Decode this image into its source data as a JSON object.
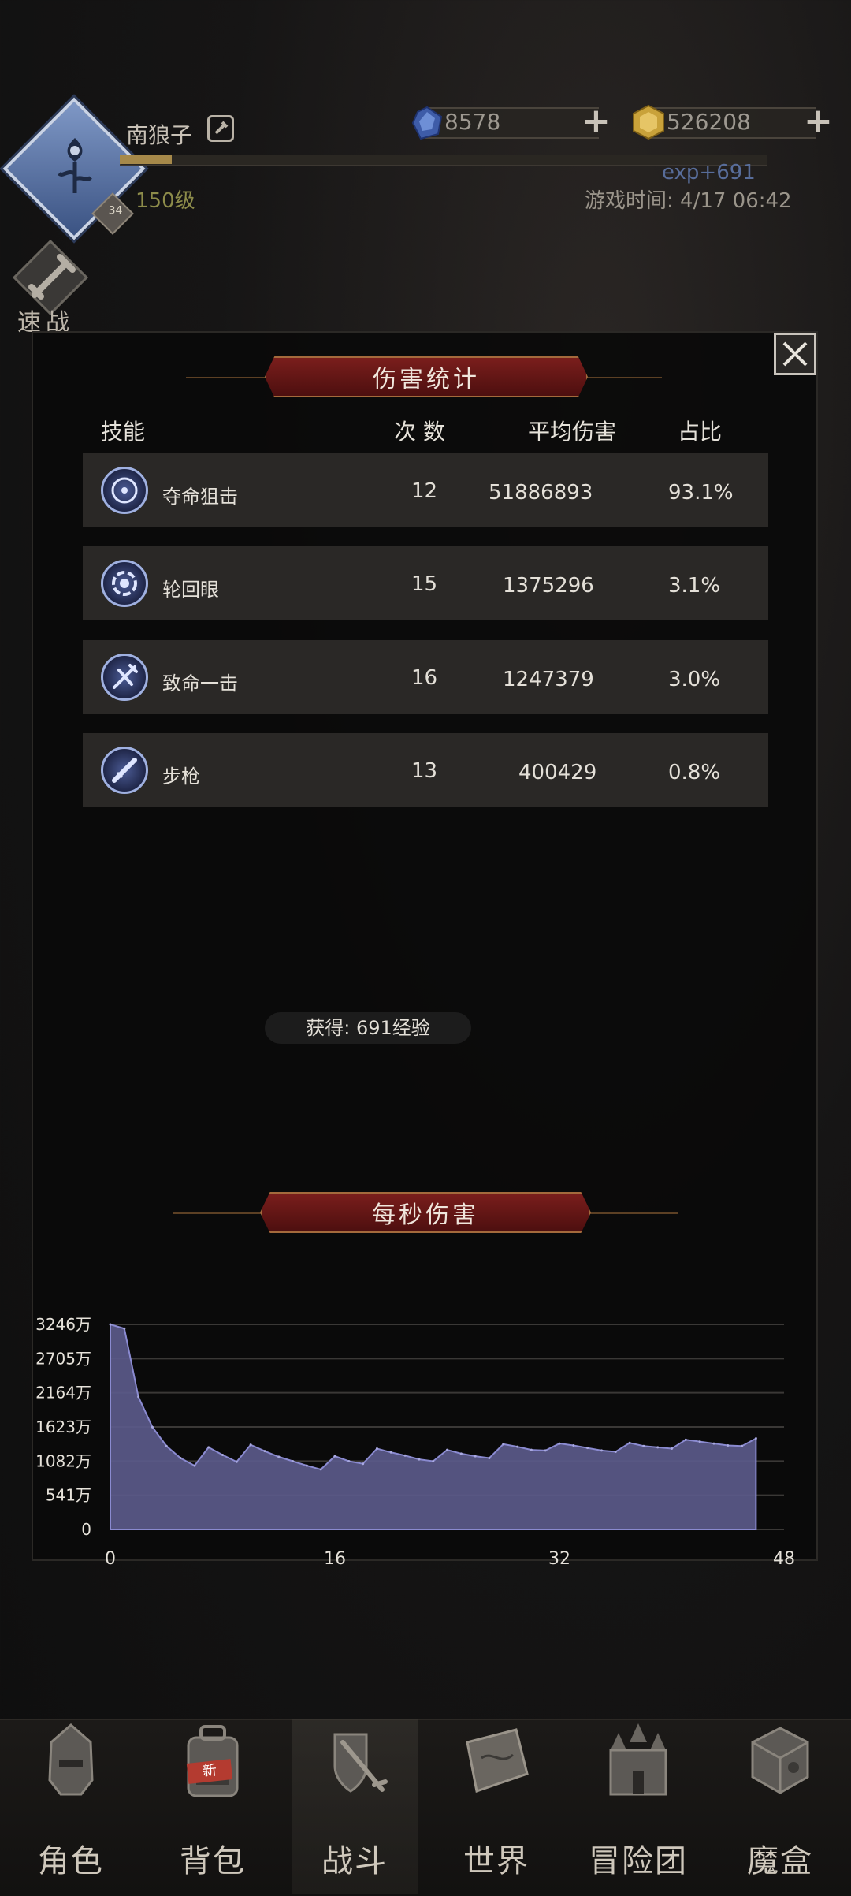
{
  "player": {
    "name": "南狼子",
    "level_text": "150级",
    "badge": "34",
    "exp_gain": "exp+691",
    "game_time": "游戏时间: 4/17 06:42",
    "xp_progress": 0.08
  },
  "resources": {
    "gems": "8578",
    "gold": "526208"
  },
  "quick_battle": {
    "label": "速战",
    "icon": "sword-icon"
  },
  "damage_stats": {
    "title": "伤害统计",
    "headers": {
      "skill": "技能",
      "count": "次 数",
      "avg": "平均伤害",
      "ratio": "占比"
    },
    "rows": [
      {
        "name": "夺命狙击",
        "count": "12",
        "avg": "51886893",
        "ratio": "93.1%",
        "icon": "sniper-target-icon"
      },
      {
        "name": "轮回眼",
        "count": "15",
        "avg": "1375296",
        "ratio": "3.1%",
        "icon": "eye-spiral-icon"
      },
      {
        "name": "致命一击",
        "count": "16",
        "avg": "1247379",
        "ratio": "3.0%",
        "icon": "critical-strike-icon"
      },
      {
        "name": "步枪",
        "count": "13",
        "avg": "400429",
        "ratio": "0.8%",
        "icon": "rifle-icon"
      }
    ],
    "reward": "获得: 691经验"
  },
  "dps": {
    "title": "每秒伤害"
  },
  "chart_data": {
    "type": "area",
    "title": "每秒伤害",
    "xlabel": "",
    "ylabel": "",
    "x_ticks": [
      "0",
      "16",
      "32",
      "48"
    ],
    "y_ticks": [
      "0",
      "541万",
      "1082万",
      "1623万",
      "2164万",
      "2705万",
      "3246万"
    ],
    "xlim": [
      0,
      48
    ],
    "ylim": [
      0,
      3246
    ],
    "grid": true,
    "color": "#5b5a8a",
    "x": [
      0,
      1,
      2,
      3,
      4,
      5,
      6,
      7,
      8,
      9,
      10,
      11,
      12,
      13,
      14,
      15,
      16,
      17,
      18,
      19,
      20,
      21,
      22,
      23,
      24,
      25,
      26,
      27,
      28,
      29,
      30,
      31,
      32,
      33,
      34,
      35,
      36,
      37,
      38,
      39,
      40,
      41,
      42,
      43,
      44,
      45,
      46
    ],
    "values": [
      3246,
      3180,
      2100,
      1620,
      1320,
      1130,
      1010,
      1300,
      1180,
      1070,
      1340,
      1240,
      1150,
      1080,
      1010,
      950,
      1160,
      1080,
      1040,
      1280,
      1220,
      1170,
      1110,
      1080,
      1260,
      1200,
      1160,
      1130,
      1350,
      1310,
      1260,
      1250,
      1360,
      1330,
      1290,
      1250,
      1230,
      1370,
      1320,
      1300,
      1280,
      1420,
      1390,
      1360,
      1330,
      1320,
      1440
    ]
  },
  "nav": {
    "items": [
      {
        "label": "角色",
        "icon": "helmet-icon"
      },
      {
        "label": "背包",
        "icon": "backpack-icon",
        "tag": "新"
      },
      {
        "label": "战斗",
        "icon": "shield-swords-icon"
      },
      {
        "label": "世界",
        "icon": "map-scroll-icon"
      },
      {
        "label": "冒险团",
        "icon": "castle-icon"
      },
      {
        "label": "魔盒",
        "icon": "magic-cube-icon"
      }
    ],
    "active_index": 2
  },
  "colors": {
    "banner": "#7a1e1c",
    "area_fill": "#5b5a8a",
    "level_text": "#8d8c4a",
    "exp_text": "#586d9a"
  }
}
